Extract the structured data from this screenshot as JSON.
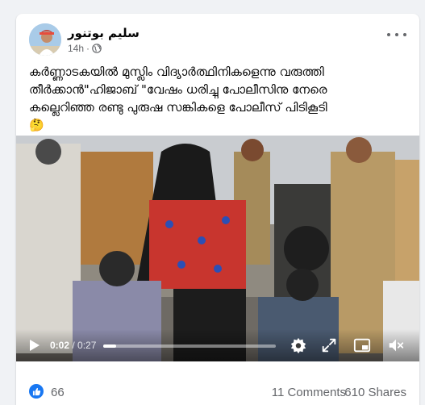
{
  "post": {
    "author": "سليم بوتنور",
    "time": "14h",
    "caption_lines": [
      "കർണ്ണാടകയിൽ മുസ്ലിം വിദ്യാർത്ഥിനികളെന്നു വരുത്തി",
      "തീർക്കാൻ\"ഹിജാബ് \"വേഷം ധരിച്ചു പോലീസിനു നേരെ",
      "കല്ലെറിഞ്ഞ രണ്ടു പുരുഷ സങ്കികളെ പോലീസ് പിടികൂടി",
      "🤔"
    ]
  },
  "video": {
    "current_time": "0:02",
    "duration": "/ 0:27",
    "progress": 0.074
  },
  "reactions": {
    "likes": "66",
    "comments": "11 Comments",
    "shares": "610 Shares"
  },
  "colors": {
    "brand": "#1877f2",
    "secondary_text": "#65676b"
  },
  "icons": [
    "globe-icon",
    "more-options-icon",
    "play-icon",
    "settings-icon",
    "fullscreen-icon",
    "pip-icon",
    "volume-icon",
    "like-icon"
  ]
}
